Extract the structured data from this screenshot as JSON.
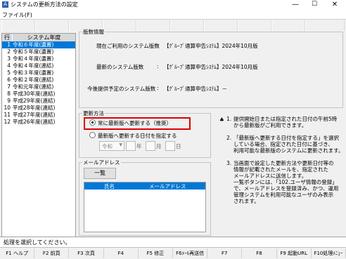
{
  "window": {
    "title": "システムの更新方法の設定",
    "minimize": "—",
    "maximize": "☐",
    "close": "✕",
    "icon": "app-icon",
    "icon_glyph": "A"
  },
  "menu": {
    "file": "ファイル(F)"
  },
  "year_list": {
    "headers": [
      "行",
      "システム年度"
    ],
    "rows": [
      {
        "n": "1",
        "label": "令和６年度(遺置)",
        "selected": true
      },
      {
        "n": "2",
        "label": "令和５年度(遺置)"
      },
      {
        "n": "3",
        "label": "令和４年度(遺置)"
      },
      {
        "n": "4",
        "label": "令和４年度(連結)"
      },
      {
        "n": "5",
        "label": "令和３年度(遺置)"
      },
      {
        "n": "6",
        "label": "令和２年度(連結)"
      },
      {
        "n": "7",
        "label": "令和元年度(連結)"
      },
      {
        "n": "8",
        "label": "平成30年度(連結)"
      },
      {
        "n": "9",
        "label": "平成29年度(連結)"
      },
      {
        "n": "10",
        "label": "平成28年度(連結)"
      },
      {
        "n": "11",
        "label": "平成27年度(連結)"
      },
      {
        "n": "12",
        "label": "平成26年度(連結)"
      }
    ]
  },
  "version_info": {
    "group_label": "版数情報",
    "rows": [
      {
        "label": "現在ご利用のシステム版数",
        "colon": ":",
        "value": "【ｸﾞﾙｰﾌﾟ通算申告ｼｽﾃﾑ】2024年10月版"
      },
      {
        "label": "最新のシステム版数",
        "colon": ":",
        "value": "【ｸﾞﾙｰﾌﾟ通算申告ｼｽﾃﾑ】2024年10月版"
      },
      {
        "label": "今後提供予定のシステム版数",
        "colon": ":",
        "value": "【ｸﾞﾙｰﾌﾟ通算申告ｼｽﾃﾑ】－"
      }
    ]
  },
  "update_method": {
    "group_label": "更新方法",
    "option1": "常に最新版へ更新する（推奨）",
    "option2": "最新版へ更新する日付を指定する",
    "era": "令和",
    "era_arrow": "▼",
    "year_unit": "年",
    "month_unit": "月",
    "day_unit": "日"
  },
  "mail": {
    "group_label": "メールアドレス",
    "list_button": "一覧",
    "columns": [
      "氏名",
      "メールアドレス"
    ]
  },
  "help": {
    "bullet": "♣",
    "notes": [
      {
        "num": "1.",
        "lines": [
          "提供開始日または指定された日付の午前5時",
          "から最新版がご利用できます。"
        ]
      },
      {
        "num": "2.",
        "lines": [
          "「最新版へ更新する日付を指定する」を選択",
          "している場合、指定された日付に基づき、",
          "利用可能な最新版のシステムに更新されます。"
        ]
      },
      {
        "num": "3.",
        "lines": [
          "当画面で設定した更新方法や更新日付等の",
          "情報が記載されたメールを、指定された",
          "メールアドレスに送信します。",
          "一覧ボタンには、「102.ユーザ情報の登録」",
          "で、メールアドレスを登録済み、かつ、運用",
          "管理システムを利用可能なユーザのみ表示",
          "されます。"
        ]
      }
    ]
  },
  "status": {
    "message": "処理を選択してください。"
  },
  "fkeys": [
    "F1 ヘルプ",
    "F2 前頁",
    "F3 次頁",
    "F4",
    "F5 修正",
    "F6ﾒｰﾙ再送信",
    "F7",
    "F8",
    "F9 起動URL",
    "F10処理ﾒﾆｭｰ"
  ]
}
